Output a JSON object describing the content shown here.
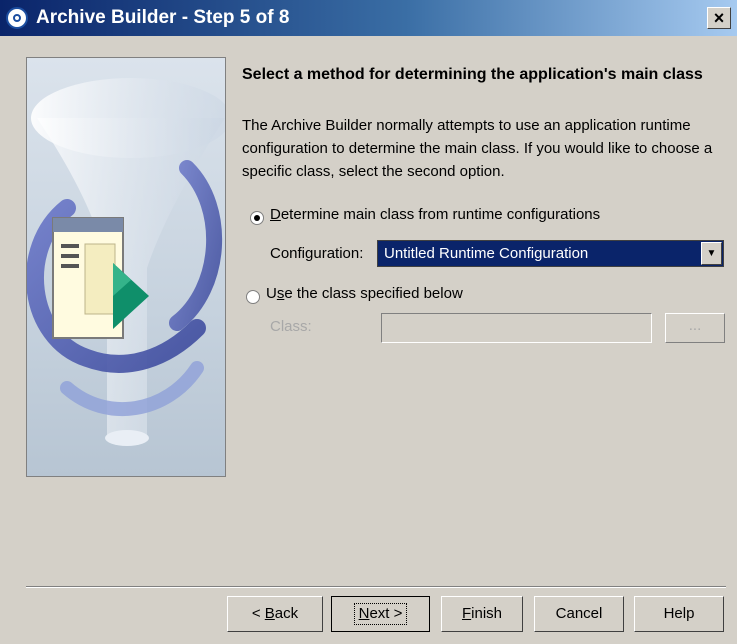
{
  "window": {
    "title": "Archive Builder - Step 5 of 8",
    "close_label": "×"
  },
  "content": {
    "heading": "Select a method for determining the application's main class",
    "description": "The Archive Builder normally attempts to use an application runtime configuration to determine the main class. If you would like to choose a specific class, select the second option."
  },
  "options": {
    "runtime": {
      "mnemonic": "D",
      "label_rest": "etermine main class from runtime configurations",
      "selected": true
    },
    "configuration": {
      "label": "Configuration:",
      "value": "Untitled Runtime Configuration"
    },
    "specified": {
      "label_before": "U",
      "mnemonic": "s",
      "label_rest": "e the class specified below",
      "selected": false
    },
    "class": {
      "label": "Class:",
      "value": "",
      "browse_label": "..."
    }
  },
  "buttons": {
    "back": {
      "prefix": "< ",
      "mnemonic": "B",
      "rest": "ack"
    },
    "next": {
      "mnemonic": "N",
      "rest": "ext >"
    },
    "finish": {
      "mnemonic": "F",
      "rest": "inish"
    },
    "cancel": "Cancel",
    "help": "Help"
  },
  "colors": {
    "dialog_bg": "#d4d0c8",
    "title_bar_start": "#0a246a",
    "selection": "#0a246a",
    "disabled_text": "#a8a8a8"
  },
  "icons": [
    "app-icon",
    "close-icon",
    "dropdown-arrow-icon",
    "wizard-illustration"
  ]
}
